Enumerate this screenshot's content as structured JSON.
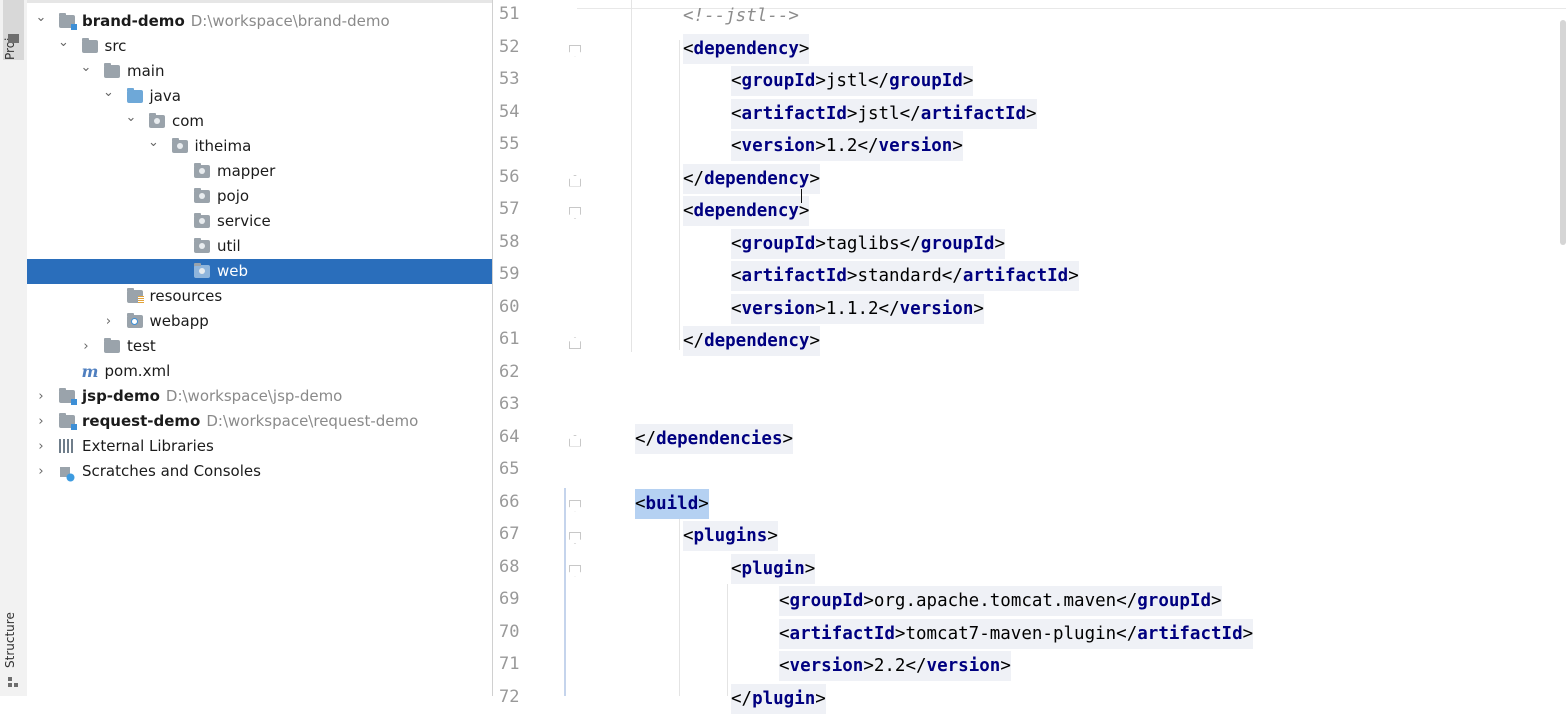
{
  "side_strip": {
    "project_tab": "Proj",
    "structure_tab": "Structure"
  },
  "tree": [
    {
      "name": "brand-demo",
      "path": "D:\\workspace\\brand-demo",
      "arrow": "⌄",
      "kind": "module",
      "bold": true
    },
    {
      "name": "src",
      "arrow": "⌄",
      "kind": "folder"
    },
    {
      "name": "main",
      "arrow": "⌄",
      "kind": "folder"
    },
    {
      "name": "java",
      "arrow": "⌄",
      "kind": "folder-blue"
    },
    {
      "name": "com",
      "arrow": "⌄",
      "kind": "package"
    },
    {
      "name": "itheima",
      "arrow": "⌄",
      "kind": "package"
    },
    {
      "name": "mapper",
      "arrow": "",
      "kind": "package"
    },
    {
      "name": "pojo",
      "arrow": "",
      "kind": "package"
    },
    {
      "name": "service",
      "arrow": "",
      "kind": "package"
    },
    {
      "name": "util",
      "arrow": "",
      "kind": "package"
    },
    {
      "name": "web",
      "arrow": "",
      "kind": "package",
      "selected": true
    },
    {
      "name": "resources",
      "arrow": "",
      "kind": "resources"
    },
    {
      "name": "webapp",
      "arrow": "›",
      "kind": "webapp"
    },
    {
      "name": "test",
      "arrow": "›",
      "kind": "folder"
    },
    {
      "name": "pom.xml",
      "arrow": "",
      "kind": "maven"
    },
    {
      "name": "jsp-demo",
      "path": "D:\\workspace\\jsp-demo",
      "arrow": "›",
      "kind": "module",
      "bold": true
    },
    {
      "name": "request-demo",
      "path": "D:\\workspace\\request-demo",
      "arrow": "›",
      "kind": "module",
      "bold": true
    },
    {
      "name": "External Libraries",
      "arrow": "›",
      "kind": "libraries"
    },
    {
      "name": "Scratches and Consoles",
      "arrow": "›",
      "kind": "scratches"
    }
  ],
  "editor": {
    "lines": [
      {
        "n": "51",
        "indent": 2,
        "parts": [
          [
            "cmt",
            "<!--jstl-->"
          ]
        ]
      },
      {
        "n": "52",
        "indent": 2,
        "fold": "down",
        "parts": [
          [
            "br",
            "<"
          ],
          [
            "tag",
            "dependency"
          ],
          [
            "br",
            ">"
          ]
        ]
      },
      {
        "n": "53",
        "indent": 3,
        "parts": [
          [
            "br",
            "<"
          ],
          [
            "tag",
            "groupId"
          ],
          [
            "br",
            ">"
          ],
          [
            "txt",
            "jstl"
          ],
          [
            "br",
            "</"
          ],
          [
            "tag",
            "groupId"
          ],
          [
            "br",
            ">"
          ]
        ]
      },
      {
        "n": "54",
        "indent": 3,
        "parts": [
          [
            "br",
            "<"
          ],
          [
            "tag",
            "artifactId"
          ],
          [
            "br",
            ">"
          ],
          [
            "txt",
            "jstl"
          ],
          [
            "br",
            "</"
          ],
          [
            "tag",
            "artifactId"
          ],
          [
            "br",
            ">"
          ]
        ]
      },
      {
        "n": "55",
        "indent": 3,
        "parts": [
          [
            "br",
            "<"
          ],
          [
            "tag",
            "version"
          ],
          [
            "br",
            ">"
          ],
          [
            "txt",
            "1.2"
          ],
          [
            "br",
            "</"
          ],
          [
            "tag",
            "version"
          ],
          [
            "br",
            ">"
          ]
        ]
      },
      {
        "n": "56",
        "indent": 2,
        "fold": "up",
        "parts": [
          [
            "br",
            "</"
          ],
          [
            "tag",
            "dependency"
          ],
          [
            "br",
            ">"
          ]
        ]
      },
      {
        "n": "57",
        "indent": 2,
        "fold": "down",
        "parts": [
          [
            "br",
            "<"
          ],
          [
            "tag",
            "dependency"
          ],
          [
            "br",
            ">"
          ]
        ]
      },
      {
        "n": "58",
        "indent": 3,
        "parts": [
          [
            "br",
            "<"
          ],
          [
            "tag",
            "groupId"
          ],
          [
            "br",
            ">"
          ],
          [
            "txt",
            "taglibs"
          ],
          [
            "br",
            "</"
          ],
          [
            "tag",
            "groupId"
          ],
          [
            "br",
            ">"
          ]
        ]
      },
      {
        "n": "59",
        "indent": 3,
        "parts": [
          [
            "br",
            "<"
          ],
          [
            "tag",
            "artifactId"
          ],
          [
            "br",
            ">"
          ],
          [
            "txt",
            "standard"
          ],
          [
            "br",
            "</"
          ],
          [
            "tag",
            "artifactId"
          ],
          [
            "br",
            ">"
          ]
        ]
      },
      {
        "n": "60",
        "indent": 3,
        "parts": [
          [
            "br",
            "<"
          ],
          [
            "tag",
            "version"
          ],
          [
            "br",
            ">"
          ],
          [
            "txt",
            "1.1.2"
          ],
          [
            "br",
            "</"
          ],
          [
            "tag",
            "version"
          ],
          [
            "br",
            ">"
          ]
        ]
      },
      {
        "n": "61",
        "indent": 2,
        "fold": "up",
        "parts": [
          [
            "br",
            "</"
          ],
          [
            "tag",
            "dependency"
          ],
          [
            "br",
            ">"
          ]
        ]
      },
      {
        "n": "62",
        "indent": 0,
        "parts": []
      },
      {
        "n": "63",
        "indent": 0,
        "parts": []
      },
      {
        "n": "64",
        "indent": 1,
        "fold": "up",
        "parts": [
          [
            "br",
            "</"
          ],
          [
            "tag",
            "dependencies"
          ],
          [
            "br",
            ">"
          ]
        ]
      },
      {
        "n": "65",
        "indent": 0,
        "parts": []
      },
      {
        "n": "66",
        "indent": 1,
        "fold": "down",
        "highlight": true,
        "parts": [
          [
            "br",
            "<"
          ],
          [
            "tag",
            "build"
          ],
          [
            "br",
            ">"
          ]
        ]
      },
      {
        "n": "67",
        "indent": 2,
        "fold": "down",
        "parts": [
          [
            "br",
            "<"
          ],
          [
            "tag",
            "plugins"
          ],
          [
            "br",
            ">"
          ]
        ]
      },
      {
        "n": "68",
        "indent": 3,
        "fold": "down",
        "parts": [
          [
            "br",
            "<"
          ],
          [
            "tag",
            "plugin"
          ],
          [
            "br",
            ">"
          ]
        ]
      },
      {
        "n": "69",
        "indent": 4,
        "parts": [
          [
            "br",
            "<"
          ],
          [
            "tag",
            "groupId"
          ],
          [
            "br",
            ">"
          ],
          [
            "txt",
            "org.apache.tomcat.maven"
          ],
          [
            "br",
            "</"
          ],
          [
            "tag",
            "groupId"
          ],
          [
            "br",
            ">"
          ]
        ]
      },
      {
        "n": "70",
        "indent": 4,
        "parts": [
          [
            "br",
            "<"
          ],
          [
            "tag",
            "artifactId"
          ],
          [
            "br",
            ">"
          ],
          [
            "txt",
            "tomcat7-maven-plugin"
          ],
          [
            "br",
            "</"
          ],
          [
            "tag",
            "artifactId"
          ],
          [
            "br",
            ">"
          ]
        ]
      },
      {
        "n": "71",
        "indent": 4,
        "parts": [
          [
            "br",
            "<"
          ],
          [
            "tag",
            "version"
          ],
          [
            "br",
            ">"
          ],
          [
            "txt",
            "2.2"
          ],
          [
            "br",
            "</"
          ],
          [
            "tag",
            "version"
          ],
          [
            "br",
            ">"
          ]
        ]
      },
      {
        "n": "72",
        "indent": 3,
        "parts": [
          [
            "br",
            "</"
          ],
          [
            "tag",
            "plugin"
          ],
          [
            "br",
            ">"
          ]
        ]
      }
    ]
  }
}
